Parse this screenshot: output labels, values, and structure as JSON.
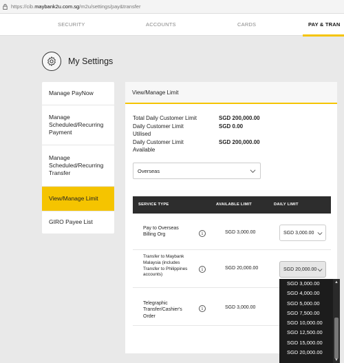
{
  "browser": {
    "url_prefix": "https://cib.",
    "url_domain": "maybank2u.com.sg",
    "url_path": "/m2u/settings/pay&transfer"
  },
  "topnav": {
    "tabs": [
      "SECURITY",
      "ACCOUNTS",
      "CARDS",
      "PAY & TRAN"
    ],
    "active_index": 3
  },
  "settings": {
    "title": "My Settings"
  },
  "sidebar": {
    "items": [
      {
        "label": "Manage PayNow"
      },
      {
        "label": "Manage Scheduled/Recurring Payment"
      },
      {
        "label": "Manage Scheduled/Recurring Transfer"
      },
      {
        "label": "View/Manage Limit"
      },
      {
        "label": "GIRO Payee List"
      }
    ],
    "active_index": 3
  },
  "panel": {
    "title": "View/Manage Limit",
    "limits": [
      {
        "label": "Total Daily Customer Limit",
        "value": "SGD 200,000.00"
      },
      {
        "label": "Daily Customer Limit Utilised",
        "value": "SGD 0.00"
      },
      {
        "label": "Daily Customer Limit Available",
        "value": "SGD 200,000.00"
      }
    ],
    "region_select": "Overseas",
    "table": {
      "headers": [
        "SERVICE TYPE",
        "AVAILABLE LIMIT",
        "DAILY LIMIT"
      ],
      "rows": [
        {
          "service": "Pay to Overseas Billing Org",
          "available": "SGD 3,000.00",
          "daily": "SGD 3,000.00"
        },
        {
          "service": "Transfer to Maybank Malaysia (includes Transfer to Philippines accounts)",
          "available": "SGD 20,000.00",
          "daily": "SGD 20,000.00"
        },
        {
          "service": "Telegraphic Transfer/Cashier's Order",
          "available": "SGD 3,000.00",
          "daily": ""
        }
      ]
    }
  },
  "dropdown": {
    "options": [
      "SGD 3,000.00",
      "SGD 4,000.00",
      "SGD 5,000.00",
      "SGD 7,500.00",
      "SGD 10,000.00",
      "SGD 12,500.00",
      "SGD 15,000.00",
      "SGD 20,000.00"
    ]
  },
  "colors": {
    "accent": "#f5c400",
    "table_header": "#2d2d2d",
    "dropdown_bg": "#1c1c1c"
  }
}
